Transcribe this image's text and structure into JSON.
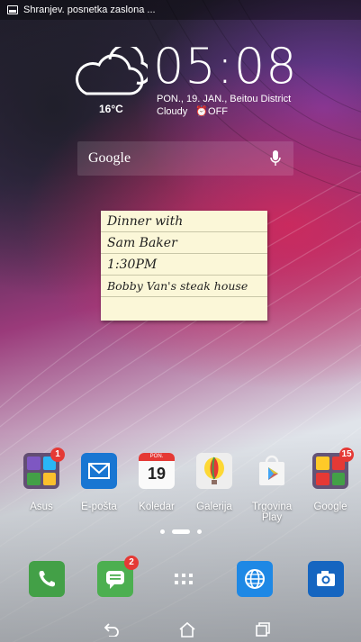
{
  "status_bar": {
    "notification_text": "Shranjev. posnetka zaslona ..."
  },
  "clock_widget": {
    "time": "05:08",
    "temperature": "16°C",
    "date_location": "PON., 19. JAN., Beitou District",
    "condition": "Cloudy",
    "alarm": "OFF",
    "weather_icon": "cloud-icon"
  },
  "search_bar": {
    "label": "Google",
    "mic_icon": "microphone-icon"
  },
  "memo_widget": {
    "lines": [
      "Dinner with",
      "Sam Baker",
      "1:30PM",
      "Bobby Van's steak house"
    ]
  },
  "apps": [
    {
      "label": "Asus",
      "badge": "1"
    },
    {
      "label": "E-pošta"
    },
    {
      "label": "Koledar",
      "month": "PON.",
      "day": "19"
    },
    {
      "label": "Galerija"
    },
    {
      "label": "Trgovina Play"
    },
    {
      "label": "Google",
      "badge": "15"
    }
  ],
  "page_indicator": {
    "pages": 3,
    "current": 2
  },
  "dock": [
    {
      "name": "phone"
    },
    {
      "name": "messages",
      "badge": "2"
    },
    {
      "name": "all-apps"
    },
    {
      "name": "browser"
    },
    {
      "name": "camera"
    }
  ],
  "colors": {
    "badge": "#e53935",
    "phone": "#43a047",
    "messages": "#4caf50",
    "browser": "#1e88e5",
    "email": "#1976d2"
  }
}
